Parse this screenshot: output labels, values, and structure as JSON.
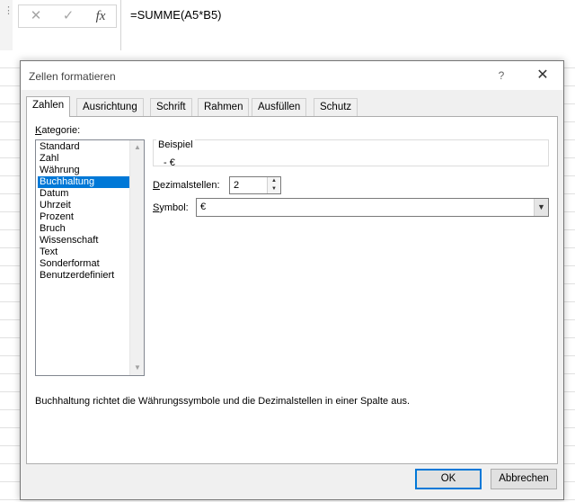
{
  "excel": {
    "toolbar": {
      "cancel_glyph": "✕",
      "enter_glyph": "✓",
      "fx_glyph": "fx"
    },
    "formula": "=SUMME(A5*B5)",
    "dots": "⋮"
  },
  "dialog": {
    "title": "Zellen formatieren",
    "help_glyph": "?",
    "close_glyph": "✕",
    "tabs": [
      {
        "label": "Zahlen",
        "active": true
      },
      {
        "label": "Ausrichtung"
      },
      {
        "label": "Schrift"
      },
      {
        "label": "Rahmen"
      },
      {
        "label": "Ausfüllen"
      },
      {
        "label": "Schutz"
      }
    ],
    "kategorie_label_underlined": "K",
    "kategorie_label_rest": "ategorie:",
    "categories": [
      "Standard",
      "Zahl",
      "Währung",
      "Buchhaltung",
      "Datum",
      "Uhrzeit",
      "Prozent",
      "Bruch",
      "Wissenschaft",
      "Text",
      "Sonderformat",
      "Benutzerdefiniert"
    ],
    "selected_category": "Buchhaltung",
    "beispiel_label": "Beispiel",
    "beispiel_value": "-   €",
    "dezimal_label_underlined": "D",
    "dezimal_label_rest": "ezimalstellen:",
    "dezimal_value": "2",
    "symbol_label_underlined": "S",
    "symbol_label_rest": "ymbol:",
    "symbol_value": "€",
    "description": "Buchhaltung richtet die Währungssymbole und die Dezimalstellen in einer Spalte aus.",
    "ok_label": "OK",
    "cancel_label": "Abbrechen"
  },
  "colors": {
    "accent": "#0078d7",
    "dialog_bg": "#f0f0f0",
    "panel_bg": "#ffffff"
  }
}
